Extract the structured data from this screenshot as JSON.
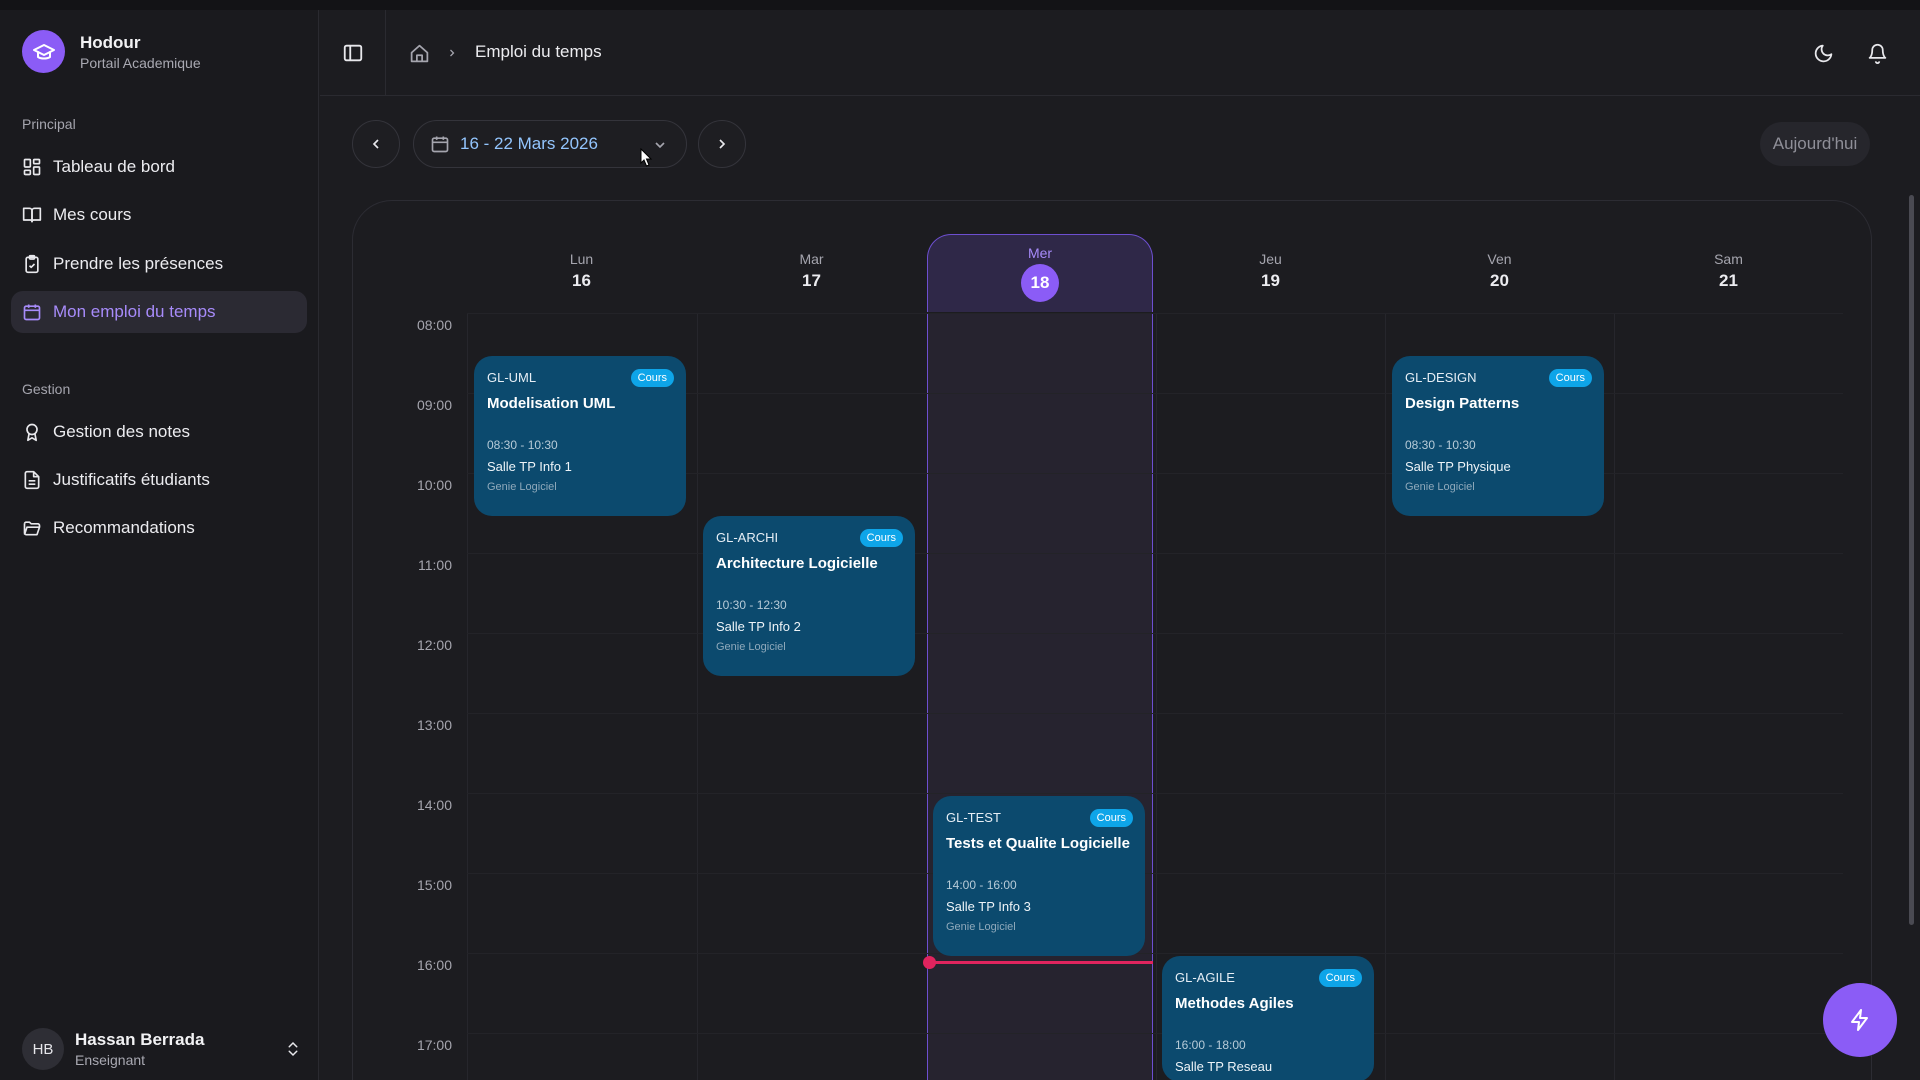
{
  "brand": {
    "name": "Hodour",
    "subtitle": "Portail Academique"
  },
  "sidebar": {
    "sections": [
      {
        "label": "Principal"
      },
      {
        "label": "Gestion"
      }
    ],
    "items": [
      {
        "label": "Tableau de bord",
        "icon": "dashboard-icon"
      },
      {
        "label": "Mes cours",
        "icon": "book-icon"
      },
      {
        "label": "Prendre les présences",
        "icon": "clipboard-check-icon"
      },
      {
        "label": "Mon emploi du temps",
        "icon": "calendar-icon",
        "active": true
      },
      {
        "label": "Gestion des notes",
        "icon": "award-icon"
      },
      {
        "label": "Justificatifs étudiants",
        "icon": "file-text-icon"
      },
      {
        "label": "Recommandations",
        "icon": "folder-open-icon"
      }
    ]
  },
  "user": {
    "initials": "HB",
    "name": "Hassan Berrada",
    "role": "Enseignant"
  },
  "header": {
    "breadcrumb_current": "Emploi du temps"
  },
  "toolbar": {
    "date_range": "16 - 22 Mars 2026",
    "today_label": "Aujourd'hui"
  },
  "calendar": {
    "days": [
      {
        "name": "Lun",
        "num": "16"
      },
      {
        "name": "Mar",
        "num": "17"
      },
      {
        "name": "Mer",
        "num": "18",
        "today": true
      },
      {
        "name": "Jeu",
        "num": "19"
      },
      {
        "name": "Ven",
        "num": "20"
      },
      {
        "name": "Sam",
        "num": "21"
      }
    ],
    "hours": [
      "08:00",
      "09:00",
      "10:00",
      "11:00",
      "12:00",
      "13:00",
      "14:00",
      "15:00",
      "16:00",
      "17:00"
    ],
    "events": [
      {
        "code": "GL-UML",
        "badge": "Cours",
        "title": "Modelisation UML",
        "time": "08:30 - 10:30",
        "room": "Salle TP Info 1",
        "dept": "Genie Logiciel"
      },
      {
        "code": "GL-ARCHI",
        "badge": "Cours",
        "title": "Architecture Logicielle",
        "time": "10:30 - 12:30",
        "room": "Salle TP Info 2",
        "dept": "Genie Logiciel"
      },
      {
        "code": "GL-TEST",
        "badge": "Cours",
        "title": "Tests et Qualite Logicielle",
        "time": "14:00 - 16:00",
        "room": "Salle TP Info 3",
        "dept": "Genie Logiciel"
      },
      {
        "code": "GL-AGILE",
        "badge": "Cours",
        "title": "Methodes Agiles",
        "time": "16:00 - 18:00",
        "room": "Salle TP Reseau",
        "dept": ""
      },
      {
        "code": "GL-DESIGN",
        "badge": "Cours",
        "title": "Design Patterns",
        "time": "08:30 - 10:30",
        "room": "Salle TP Physique",
        "dept": "Genie Logiciel"
      }
    ]
  },
  "colors": {
    "accent": "#8b5cf6",
    "event_bg": "#0c4a6e",
    "badge": "#0ea5e9",
    "now_line": "#e0245e"
  }
}
